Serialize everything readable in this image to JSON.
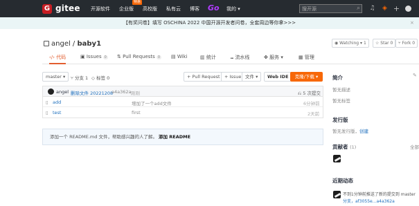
{
  "nav": {
    "logo_letter": "G",
    "brand": "gitee",
    "menu": [
      "开源软件",
      "企业版",
      "高校版",
      "私有云",
      "博客"
    ],
    "hot_badge": "特惠",
    "go": "Go",
    "mine": "我的",
    "search_placeholder": "搜开源"
  },
  "banner": {
    "text": "【有奖问卷】填写 OSCHINA 2022 中国开源开发者问卷，全套周边等你拿>>>",
    "close": "×"
  },
  "repo": {
    "owner": "angel",
    "name": "baby1",
    "separator": " / ",
    "watch_label": "Watching",
    "watch_count": "1",
    "star_label": "Star",
    "star_count": "0",
    "fork_label": "Fork",
    "fork_count": "0"
  },
  "tabs": [
    {
      "label": "代码",
      "icon": "code-icon",
      "active": true
    },
    {
      "label": "Issues",
      "count": "0"
    },
    {
      "label": "Pull Requests",
      "count": "0"
    },
    {
      "label": "Wiki"
    },
    {
      "label": "统计"
    },
    {
      "label": "流水线"
    },
    {
      "label": "服务"
    },
    {
      "label": "管理"
    }
  ],
  "toolbar": {
    "branch": "master",
    "branches": "分支 1",
    "tags": "标签 0",
    "pull_request": "+ Pull Request",
    "issue": "+ Issue",
    "file": "文件",
    "webide": "Web IDE",
    "clone": "克隆/下载"
  },
  "commit": {
    "author": "angel",
    "message": "删除文件 20221208",
    "hash": "a4a362a",
    "time": "刚刚",
    "count": "5 次提交"
  },
  "files": [
    {
      "name": "add",
      "message": "增加了一个add文件",
      "time": "6分钟前"
    },
    {
      "name": "test",
      "message": "first",
      "time": "2天前"
    }
  ],
  "readme": {
    "text": "添加一个 README.md 文件，帮助感兴趣的人了解。",
    "action": "添加 README"
  },
  "sidebar": {
    "intro_title": "简介",
    "intro_desc": "暂无描述",
    "intro_tags": "暂无标签",
    "release_title": "发行版",
    "release_text": "暂无发行版，",
    "release_link": "创建",
    "contrib_title": "贡献者",
    "contrib_count": "(1)",
    "contrib_all": "全部",
    "activity_title": "近期动态",
    "activity_line1": "不到1分钟前推送了新的提交到 master",
    "activity_line2": "分支，af3055e...a4a362a"
  },
  "colors": {
    "nav_bg": "#262b30",
    "brand_red": "#c71d23",
    "accent_orange": "#f76707",
    "banner_bg": "#eaf5f6"
  }
}
